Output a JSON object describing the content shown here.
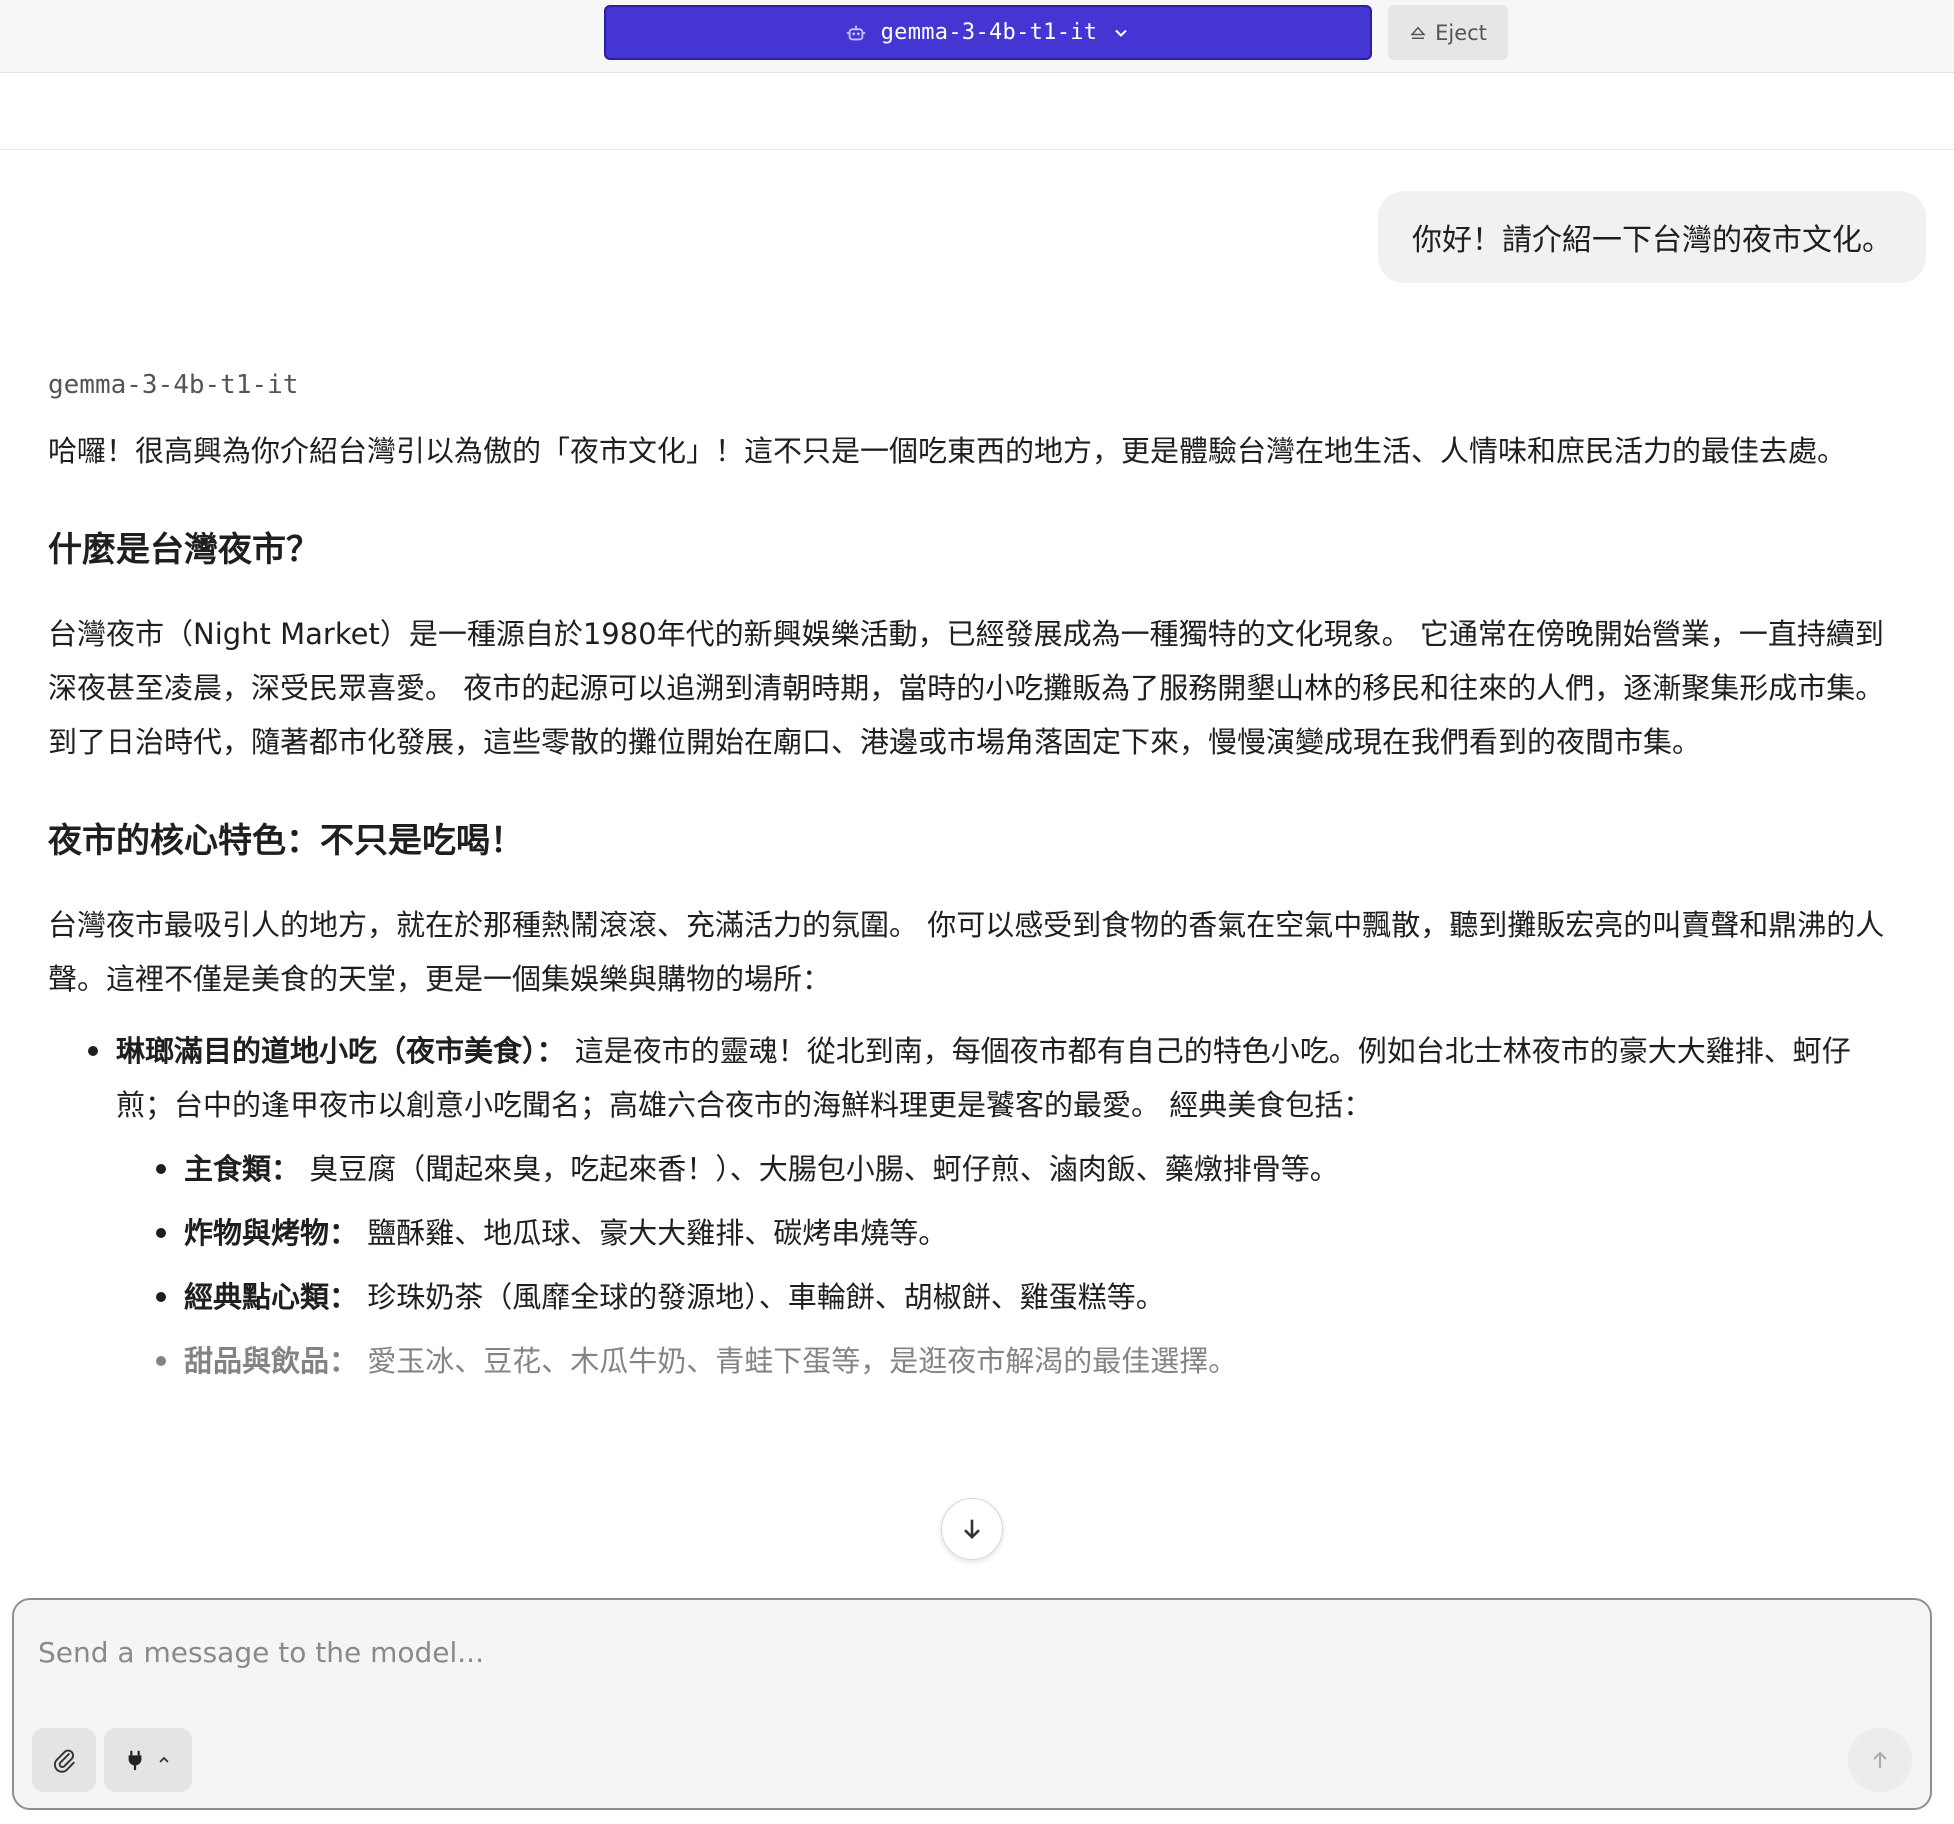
{
  "header": {
    "model_name": "gemma-3-4b-t1-it",
    "eject_label": "Eject"
  },
  "conversation": {
    "user_message": "你好！請介紹一下台灣的夜市文化。",
    "assistant_name": "gemma-3-4b-t1-it",
    "intro": "哈囉！很高興為你介紹台灣引以為傲的「夜市文化」！這不只是一個吃東西的地方，更是體驗台灣在地生活、人情味和庶民活力的最佳去處。",
    "section1_title": "什麼是台灣夜市？",
    "section1_body": "台灣夜市（Night Market）是一種源自於1980年代的新興娛樂活動，已經發展成為一種獨特的文化現象。 它通常在傍晚開始營業，一直持續到深夜甚至凌晨，深受民眾喜愛。 夜市的起源可以追溯到清朝時期，當時的小吃攤販為了服務開墾山林的移民和往來的人們，逐漸聚集形成市集。 到了日治時代，隨著都市化發展，這些零散的攤位開始在廟口、港邊或市場角落固定下來，慢慢演變成現在我們看到的夜間市集。",
    "section2_title": "夜市的核心特色：不只是吃喝！",
    "section2_body": "台灣夜市最吸引人的地方，就在於那種熱鬧滾滾、充滿活力的氛圍。 你可以感受到食物的香氣在空氣中飄散，聽到攤販宏亮的叫賣聲和鼎沸的人聲。這裡不僅是美食的天堂，更是一個集娛樂與購物的場所：",
    "bullet1_title": "琳瑯滿目的道地小吃（夜市美食）：",
    "bullet1_body": " 這是夜市的靈魂！從北到南，每個夜市都有自己的特色小吃。例如台北士林夜市的豪大大雞排、蚵仔煎；台中的逢甲夜市以創意小吃聞名；高雄六合夜市的海鮮料理更是饕客的最愛。 經典美食包括：",
    "sub_items": [
      {
        "title": "主食類：",
        "body": " 臭豆腐（聞起來臭，吃起來香！）、大腸包小腸、蚵仔煎、滷肉飯、藥燉排骨等。"
      },
      {
        "title": "炸物與烤物：",
        "body": " 鹽酥雞、地瓜球、豪大大雞排、碳烤串燒等。"
      },
      {
        "title": "經典點心類：",
        "body": " 珍珠奶茶（風靡全球的發源地）、車輪餅、胡椒餅、雞蛋糕等。"
      },
      {
        "title": "甜品與飲品：",
        "body": " 愛玉冰、豆花、木瓜牛奶、青蛙下蛋等，是逛夜市解渴的最佳選擇。"
      }
    ]
  },
  "composer": {
    "placeholder": "Send a message to the model..."
  }
}
